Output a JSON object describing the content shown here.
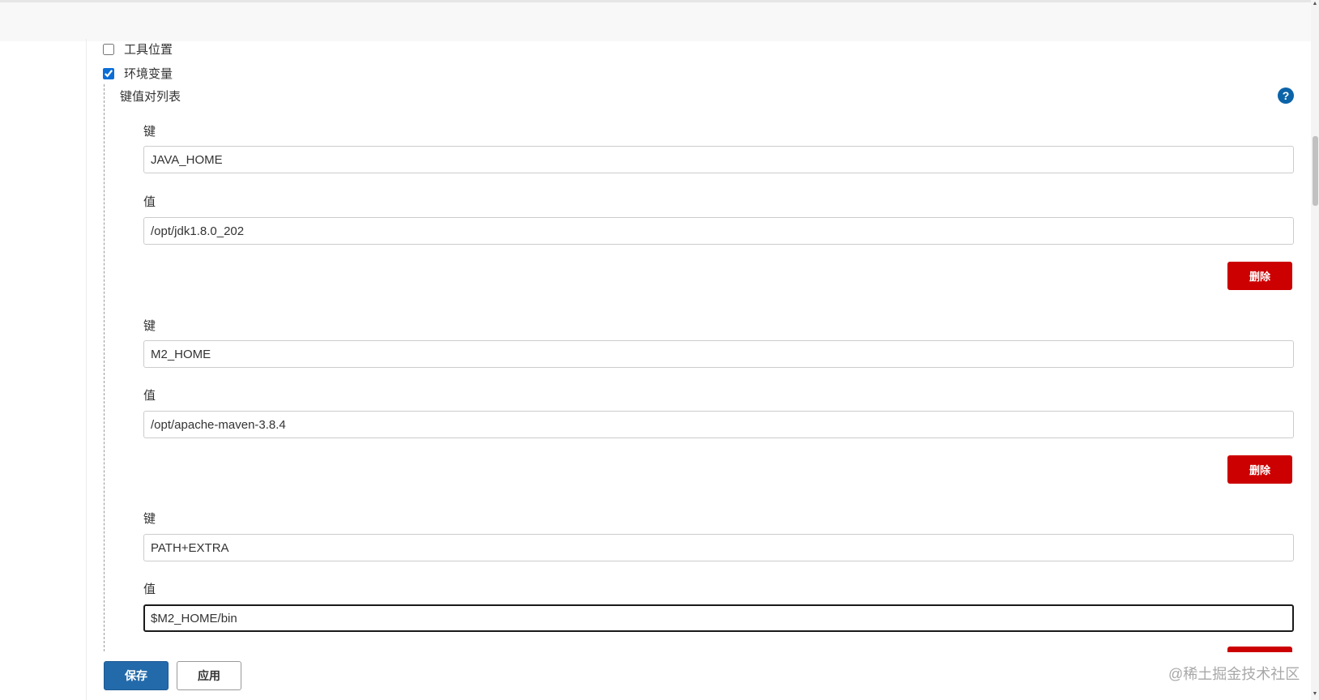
{
  "options": {
    "tool_location": {
      "label": "工具位置",
      "checked": false
    },
    "env_vars": {
      "label": "环境变量",
      "checked": true
    }
  },
  "kv_list": {
    "title": "键值对列表",
    "help_icon_glyph": "?",
    "key_label": "键",
    "value_label": "值",
    "delete_label": "删除",
    "entries": [
      {
        "key": "JAVA_HOME",
        "value": "/opt/jdk1.8.0_202"
      },
      {
        "key": "M2_HOME",
        "value": "/opt/apache-maven-3.8.4"
      },
      {
        "key": "PATH+EXTRA",
        "value": "$M2_HOME/bin"
      }
    ]
  },
  "actions": {
    "save": "保存",
    "apply": "应用"
  },
  "watermark": "@稀土掘金技术社区",
  "colors": {
    "primary": "#236aab",
    "danger": "#cc0000",
    "help": "#0b63a8"
  }
}
